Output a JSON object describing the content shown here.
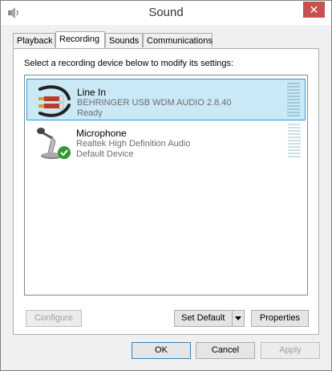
{
  "window": {
    "title": "Sound",
    "close_glyph": "✕"
  },
  "tabs": [
    {
      "label": "Playback",
      "active": false
    },
    {
      "label": "Recording",
      "active": true
    },
    {
      "label": "Sounds",
      "active": false
    },
    {
      "label": "Communications",
      "active": false
    }
  ],
  "recording": {
    "instruction": "Select a recording device below to modify its settings:",
    "devices": [
      {
        "name": "Line In",
        "description": "BEHRINGER USB WDM AUDIO 2.8.40",
        "state": "Ready",
        "selected": true,
        "icon": "line-in-jack-icon"
      },
      {
        "name": "Microphone",
        "description": "Realtek High Definition Audio",
        "state": "Default Device",
        "selected": false,
        "icon": "microphone-icon",
        "badge": "default-check-icon"
      }
    ],
    "buttons": {
      "configure": "Configure",
      "set_default": "Set Default",
      "properties": "Properties"
    }
  },
  "footer": {
    "ok": "OK",
    "cancel": "Cancel",
    "apply": "Apply"
  },
  "colors": {
    "selection": "#cbe8f6",
    "selection_border": "#26a0da",
    "close": "#c75050"
  }
}
